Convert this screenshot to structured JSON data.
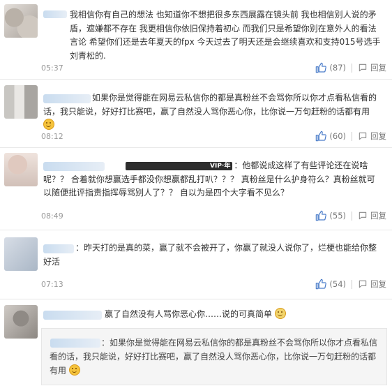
{
  "comments": [
    {
      "text": "我相信你有自己的想法 也知道你不想把很多东西展露在镜头前 我也相信别人说的矛盾，遮嫌都不存在 我更相信你依旧保持着初心 而我们只是希望你别在意外人的看法言论 希望你们还是去年夏天的fpx 今天过去了明天还是会继续喜欢和支持015号选手刘青松的.",
      "time": "05:37",
      "likes": "(87)",
      "reply": "回复",
      "avatar_icon": "user-avatar"
    },
    {
      "text": "如果你是觉得能在网易云私信你的都是真粉丝不会骂你所以你才点看私信看的话，我只能说，好好打比赛吧，赢了自然没人骂你恶心你，比你说一万句赶粉的话都有用",
      "time": "08:12",
      "likes": "(60)",
      "reply": "回复",
      "avatar_icon": "user-avatar"
    },
    {
      "badge": "VIP·年",
      "text": "：他都说成这样了有些评论还在说啥呢？？ 合着就你想赢选手都没你想赢都乱打叭？？？ 真粉丝是什么护身符么？真粉丝就可以随便批评指责指挥辱骂别人了？？ 自以为是四个大字看不见么？",
      "time": "08:49",
      "likes": "(55)",
      "reply": "回复",
      "avatar_icon": "user-avatar"
    },
    {
      "text": "：昨天打的是真的菜，赢了就不会被开了，你赢了就没人说你了，烂梗也能给你整好活",
      "time": "07:13",
      "likes": "(54)",
      "reply": "回复",
      "avatar_icon": "user-avatar"
    },
    {
      "text": "赢了自然没有人骂你恶心你……说的可真简单",
      "quote_text": "：如果你是觉得能在网易云私信你的都是真粉丝不会骂你所以你才点看私信看的话，我只能说，好好打比赛吧，赢了自然没人骂你恶心你，比你说一万句赶粉的话都有用",
      "avatar_icon": "user-avatar"
    }
  ],
  "icons": {
    "like": "thumbs-up-icon",
    "reply": "reply-icon",
    "emoji": "smile-emoji-icon"
  },
  "colors": {
    "like_blue": "#4a7cc9",
    "text": "#333333",
    "meta": "#999999"
  }
}
